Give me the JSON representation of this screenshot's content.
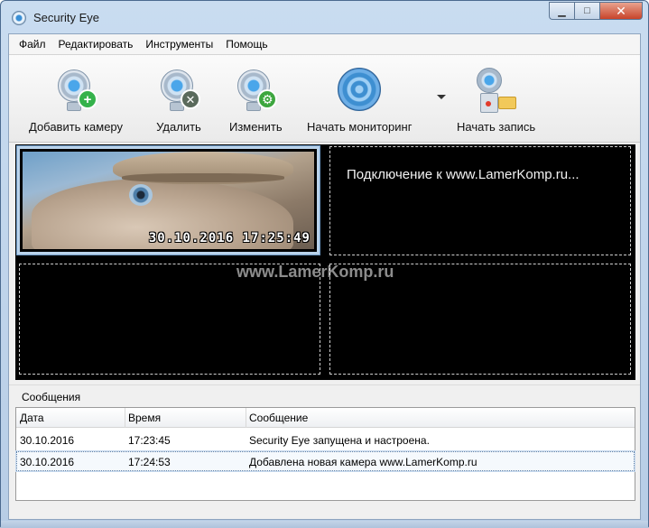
{
  "window": {
    "title": "Security Eye"
  },
  "menu": {
    "items": [
      "Файл",
      "Редактировать",
      "Инструменты",
      "Помощь"
    ]
  },
  "toolbar": {
    "add_camera": "Добавить камеру",
    "delete": "Удалить",
    "edit": "Изменить",
    "start_monitoring": "Начать мониторинг",
    "start_recording": "Начать запись"
  },
  "video": {
    "cam1_timestamp": "30.10.2016 17:25:49",
    "cam2_status": "Подключение к www.LamerKomp.ru...",
    "watermark": "www.LamerKomp.ru"
  },
  "messages": {
    "title": "Сообщения",
    "columns": [
      "Дата",
      "Время",
      "Сообщение"
    ],
    "rows": [
      {
        "date": "30.10.2016",
        "time": "17:23:45",
        "message": "Security Eye запущена и настроена."
      },
      {
        "date": "30.10.2016",
        "time": "17:24:53",
        "message": "Добавлена новая камера www.LamerKomp.ru"
      }
    ]
  },
  "colors": {
    "title_bar": "#c9dcf0",
    "video_bg": "#000000",
    "active_cell_border": "#b9d2ea"
  }
}
